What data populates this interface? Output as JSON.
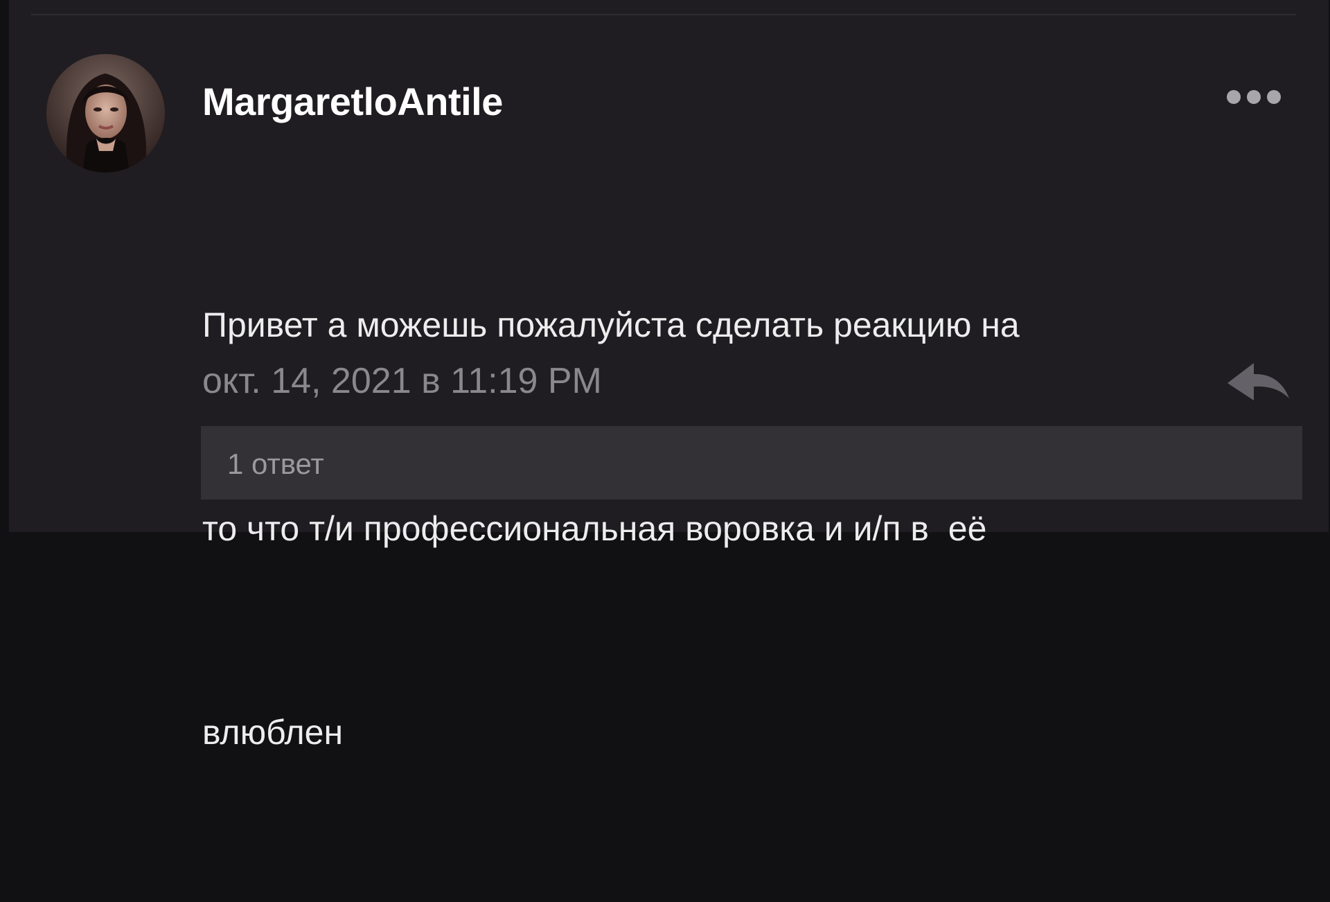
{
  "comment": {
    "username": "MargaretloAntile",
    "avatar_icon": "user-avatar-photo",
    "more_icon": "more-dots-icon",
    "message_lines": [
      "Привет а можешь пожалуйста сделать реакцию на",
      "то что т/и профессиональная воровка и и/п в  её",
      "влюблен"
    ],
    "timestamp": "окт. 14, 2021 в 11:19 PM",
    "reply_icon": "reply-arrow-icon",
    "replies_label": "1 ответ"
  },
  "colors": {
    "background": "#111113",
    "card": "#1f1d21",
    "username": "#ffffff",
    "message": "#ededee",
    "muted": "#8a888d",
    "replies_bar": "#333136"
  }
}
